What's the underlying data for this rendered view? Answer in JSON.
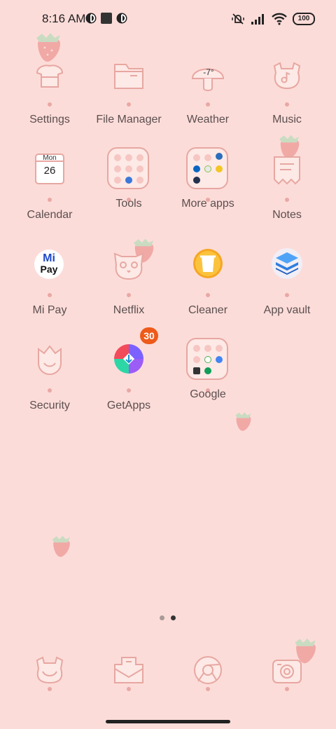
{
  "status_bar": {
    "time": "8:16 AM",
    "battery": "100",
    "icons": [
      "notification-icon-1",
      "square-notification-icon",
      "notification-icon-2",
      "silent-vibrate-icon",
      "signal-icon",
      "wifi-icon",
      "battery-icon"
    ]
  },
  "apps": {
    "row1": [
      {
        "label": "Settings",
        "icon": "settings-icon"
      },
      {
        "label": "File Manager",
        "icon": "folder-icon"
      },
      {
        "label": "Weather",
        "icon": "weather-mushroom-icon",
        "temp": "-7°"
      },
      {
        "label": "Music",
        "icon": "music-icon"
      }
    ],
    "row2": [
      {
        "label": "Calendar",
        "icon": "calendar-icon",
        "day": "Mon",
        "date": "26"
      },
      {
        "label": "Tools",
        "icon": "folder-tools-icon"
      },
      {
        "label": "More apps",
        "icon": "folder-more-apps-icon"
      },
      {
        "label": "Notes",
        "icon": "notes-icon"
      }
    ],
    "row3": [
      {
        "label": "Mi Pay",
        "icon": "mi-pay-icon",
        "logo_top": "Mi",
        "logo_bottom": "Pay"
      },
      {
        "label": "Netflix",
        "icon": "netflix-icon"
      },
      {
        "label": "Cleaner",
        "icon": "cleaner-icon"
      },
      {
        "label": "App vault",
        "icon": "app-vault-icon"
      }
    ],
    "row4": [
      {
        "label": "Security",
        "icon": "security-icon"
      },
      {
        "label": "GetApps",
        "icon": "getapps-icon",
        "badge": "30"
      },
      {
        "label": "Google",
        "icon": "folder-google-icon"
      }
    ]
  },
  "dock": [
    {
      "icon": "phone-icon"
    },
    {
      "icon": "messages-icon"
    },
    {
      "icon": "browser-icon"
    },
    {
      "icon": "camera-icon"
    }
  ],
  "page_indicator": {
    "pages": 2,
    "active": 2
  },
  "colors": {
    "background": "#fcdcd9",
    "icon_stroke": "#e7a7a1",
    "label": "#5b4f4f",
    "badge": "#ee5a1a"
  }
}
